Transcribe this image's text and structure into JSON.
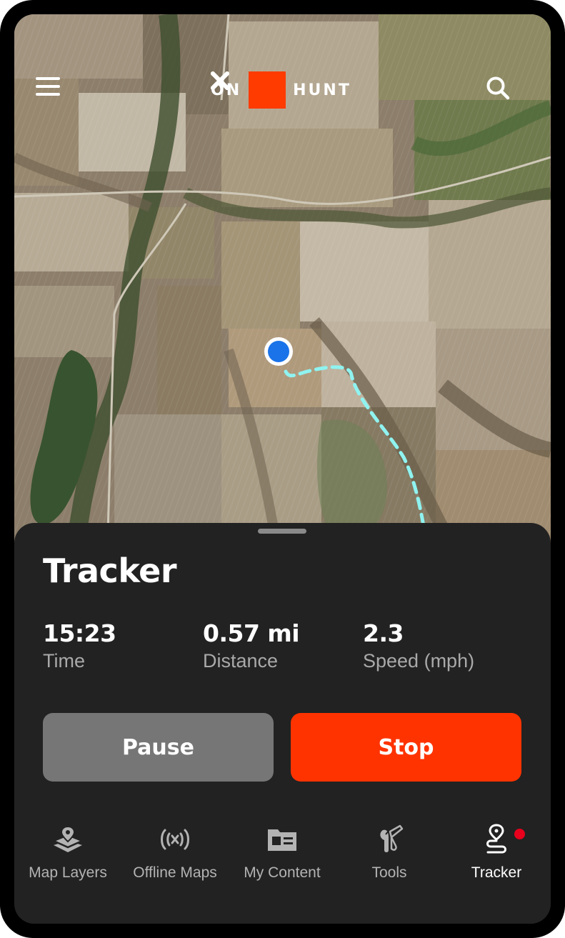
{
  "app": {
    "logo_left": "ON",
    "logo_right": "HUNT",
    "accent_color": "#ff3b00"
  },
  "header": {
    "menu_icon": "hamburger-menu-icon",
    "search_icon": "search-icon"
  },
  "map": {
    "location_marker_color": "#1a73e8",
    "track_color": "#8ff3f0",
    "track_style": "dashed"
  },
  "tracker": {
    "title": "Tracker",
    "stats": [
      {
        "value": "15:23",
        "label": "Time"
      },
      {
        "value": "0.57 mi",
        "label": "Distance"
      },
      {
        "value": "2.3",
        "label": "Speed (mph)"
      }
    ],
    "pause_label": "Pause",
    "stop_label": "Stop",
    "stop_color": "#ff3300"
  },
  "nav": {
    "items": [
      {
        "label": "Map Layers",
        "icon": "map-layers-icon"
      },
      {
        "label": "Offline Maps",
        "icon": "offline-maps-icon"
      },
      {
        "label": "My Content",
        "icon": "my-content-icon"
      },
      {
        "label": "Tools",
        "icon": "tools-icon"
      },
      {
        "label": "Tracker",
        "icon": "tracker-icon",
        "active": true,
        "notification_dot": true
      }
    ]
  }
}
